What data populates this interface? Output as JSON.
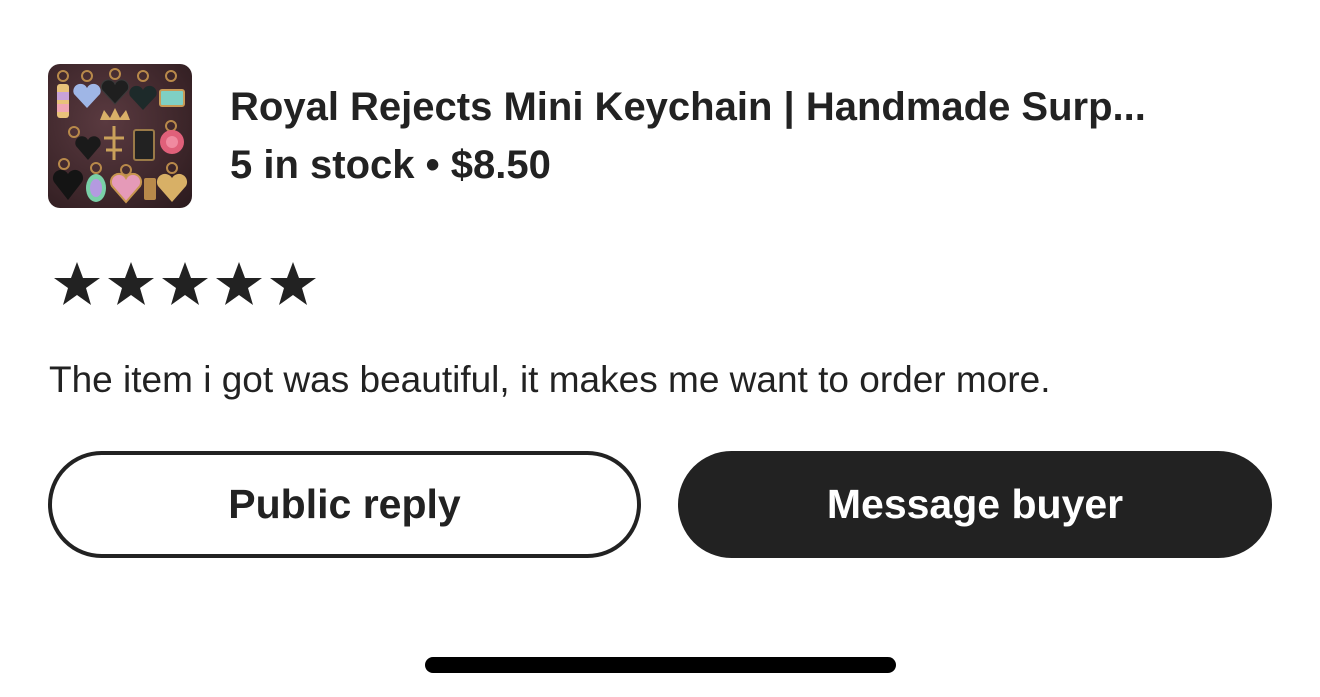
{
  "product": {
    "thumbnail_icon": "keychain-charms-thumbnail",
    "title": "Royal Rejects Mini Keychain | Handmade Surp...",
    "stock_price": "5 in stock • $8.50"
  },
  "review": {
    "rating": 5,
    "rating_max": 5,
    "star_icon": "star-icon",
    "star_color": "#222222",
    "text": "The item i got was beautiful, it makes me want to order more."
  },
  "actions": {
    "public_reply_label": "Public reply",
    "message_buyer_label": "Message buyer"
  },
  "colors": {
    "text": "#222222",
    "primary_button_bg": "#222222",
    "primary_button_text": "#ffffff",
    "background": "#ffffff"
  }
}
